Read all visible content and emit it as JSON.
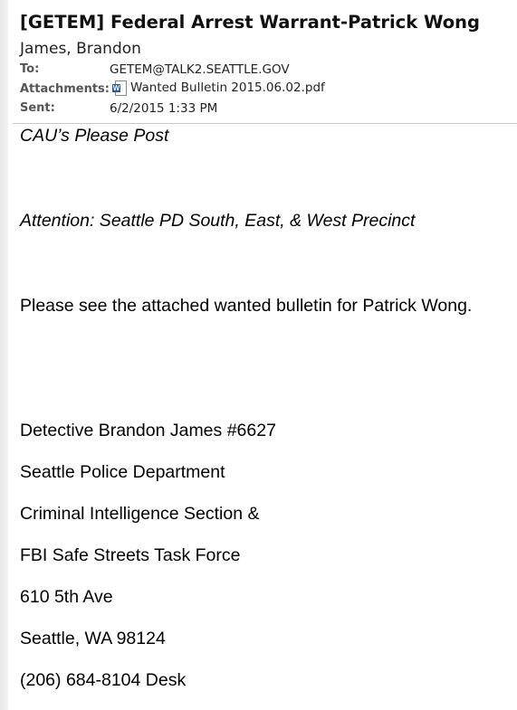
{
  "email": {
    "subject": "[GETEM] Federal Arrest Warrant-Patrick Wong",
    "sender": "James, Brandon",
    "to_label": "To:",
    "to_value": "GETEM@TALK2.SEATTLE.GOV",
    "attachments_label": "Attachments:",
    "attachment_name": "Wanted Bulletin 2015.06.02.pdf",
    "attachment_icon": "word-document-icon",
    "sent_label": "Sent:",
    "sent_value": "6/2/2015 1:33 PM"
  },
  "body": {
    "line1": "CAU’s Please Post",
    "line2": "Attention: Seattle PD South, East, & West Precinct",
    "line3": "Please see the attached wanted bulletin for Patrick Wong.",
    "signature": [
      "Detective Brandon James #6627",
      "Seattle Police Department",
      "Criminal Intelligence Section &",
      "FBI Safe Streets Task Force",
      "610 5th Ave",
      "Seattle, WA 98124",
      "(206) 684-8104 Desk"
    ]
  }
}
